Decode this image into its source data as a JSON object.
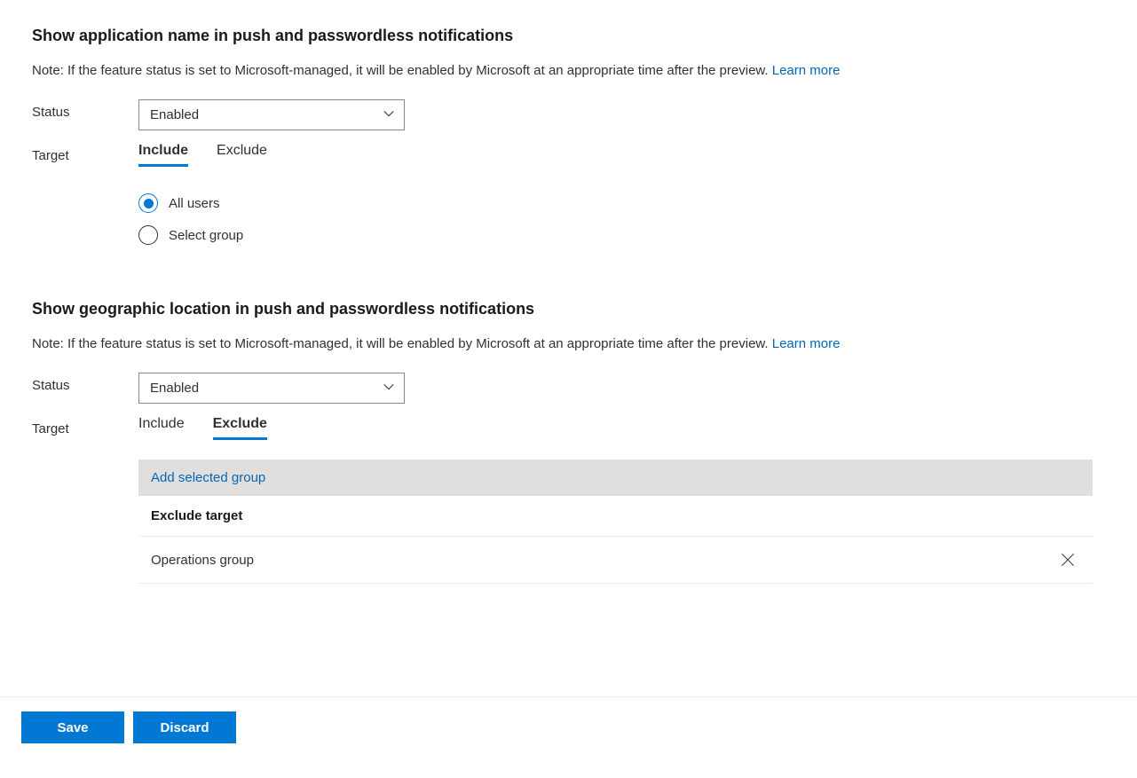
{
  "section1": {
    "title": "Show application name in push and passwordless notifications",
    "note": "Note: If the feature status is set to Microsoft-managed, it will be enabled by Microsoft at an appropriate time after the preview. ",
    "learn_more": "Learn more",
    "status_label": "Status",
    "status_value": "Enabled",
    "target_label": "Target",
    "tab_include": "Include",
    "tab_exclude": "Exclude",
    "radio_all_users": "All users",
    "radio_select_group": "Select group"
  },
  "section2": {
    "title": "Show geographic location in push and passwordless notifications",
    "note": "Note: If the feature status is set to Microsoft-managed, it will be enabled by Microsoft at an appropriate time after the preview. ",
    "learn_more": "Learn more",
    "status_label": "Status",
    "status_value": "Enabled",
    "target_label": "Target",
    "tab_include": "Include",
    "tab_exclude": "Exclude",
    "add_group": "Add selected group",
    "exclude_header": "Exclude target",
    "exclude_items": {
      "0": "Operations group"
    }
  },
  "footer": {
    "save": "Save",
    "discard": "Discard"
  }
}
